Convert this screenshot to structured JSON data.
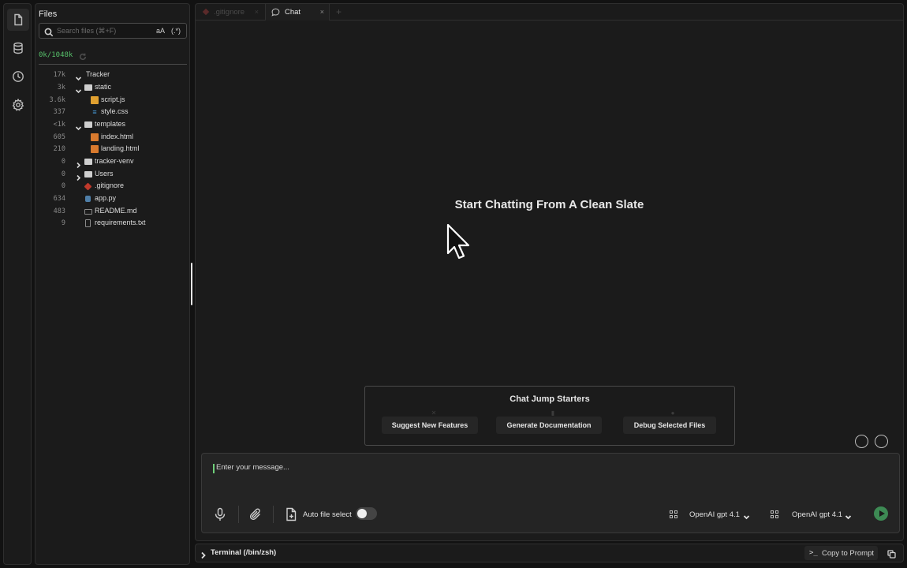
{
  "activity_bar": {
    "items": [
      {
        "icon": "file-icon",
        "active": true
      },
      {
        "icon": "database-icon",
        "active": false
      },
      {
        "icon": "clock-icon",
        "active": false
      },
      {
        "icon": "gear-icon",
        "active": false
      }
    ]
  },
  "files_panel": {
    "title": "Files",
    "search": {
      "placeholder": "Search files (⌘+F)",
      "case_toggle": "aA",
      "regex_toggle": "(.*)"
    },
    "token_count": "0k/1048k",
    "tree": [
      {
        "size": "17k",
        "name": "Tracker",
        "type": "folder-open"
      },
      {
        "size": "3k",
        "name": "static",
        "type": "folder-open"
      },
      {
        "size": "3.6k",
        "name": "script.js",
        "type": "js"
      },
      {
        "size": "337",
        "name": "style.css",
        "type": "css"
      },
      {
        "size": "<1k",
        "name": "templates",
        "type": "folder-open"
      },
      {
        "size": "605",
        "name": "index.html",
        "type": "html"
      },
      {
        "size": "210",
        "name": "landing.html",
        "type": "html"
      },
      {
        "size": "0",
        "name": "tracker-venv",
        "type": "folder-closed"
      },
      {
        "size": "0",
        "name": "Users",
        "type": "folder-closed"
      },
      {
        "size": "0",
        "name": ".gitignore",
        "type": "git"
      },
      {
        "size": "634",
        "name": "app.py",
        "type": "py"
      },
      {
        "size": "483",
        "name": "README.md",
        "type": "md"
      },
      {
        "size": "9",
        "name": "requirements.txt",
        "type": "txt"
      }
    ]
  },
  "tabs": [
    {
      "label": ".gitignore",
      "active": false
    },
    {
      "label": "Chat",
      "active": true
    }
  ],
  "chat": {
    "empty_heading": "Start Chatting From A Clean Slate",
    "starters_title": "Chat Jump Starters",
    "starters": [
      "Suggest New Features",
      "Generate Documentation",
      "Debug Selected Files"
    ],
    "input_placeholder": "Enter your message...",
    "auto_file_select_label": "Auto file select",
    "auto_file_select_on": false,
    "models": [
      "OpenAI gpt 4.1",
      "OpenAI gpt 4.1"
    ]
  },
  "terminal": {
    "label": "Terminal (/bin/zsh)",
    "copy_to_prompt": "Copy to Prompt"
  },
  "colors": {
    "accent_green": "#57c06a",
    "send_button": "#3d8a54",
    "background": "#121212",
    "panel": "#1b1b1b"
  }
}
